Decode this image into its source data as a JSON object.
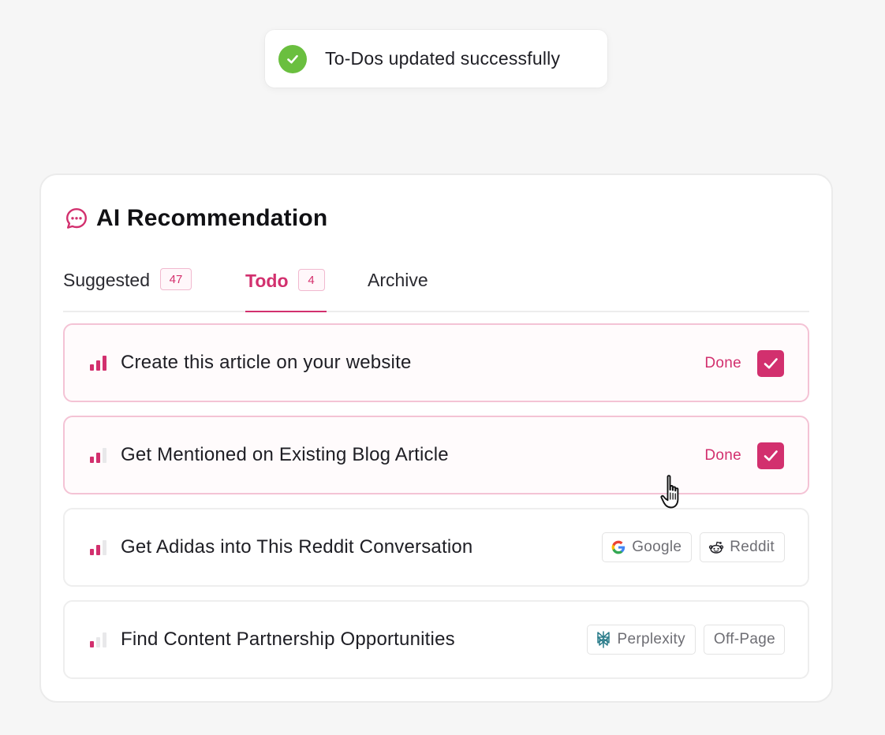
{
  "toast": {
    "message": "To-Dos updated successfully",
    "icon": "check-circle-icon",
    "color": "#6abf3f"
  },
  "card": {
    "title": "AI Recommendation",
    "icon": "chat-bubble-icon",
    "accent": "#d2306e"
  },
  "tabs": [
    {
      "label": "Suggested",
      "count": "47",
      "active": false
    },
    {
      "label": "Todo",
      "count": "4",
      "active": true
    },
    {
      "label": "Archive",
      "active": false
    }
  ],
  "items": [
    {
      "title": "Create this article on your website",
      "priority_level": 3,
      "status": "Done",
      "checked": true
    },
    {
      "title": "Get Mentioned on Existing Blog Article",
      "priority_level": 2,
      "status": "Done",
      "checked": true
    },
    {
      "title": "Get Adidas into This Reddit Conversation",
      "priority_level": 2,
      "tags": [
        {
          "label": "Google",
          "icon": "google-icon"
        },
        {
          "label": "Reddit",
          "icon": "reddit-icon"
        }
      ]
    },
    {
      "title": "Find Content Partnership Opportunities",
      "priority_level": 1,
      "tags": [
        {
          "label": "Perplexity",
          "icon": "perplexity-icon"
        },
        {
          "label": "Off-Page"
        }
      ]
    }
  ]
}
